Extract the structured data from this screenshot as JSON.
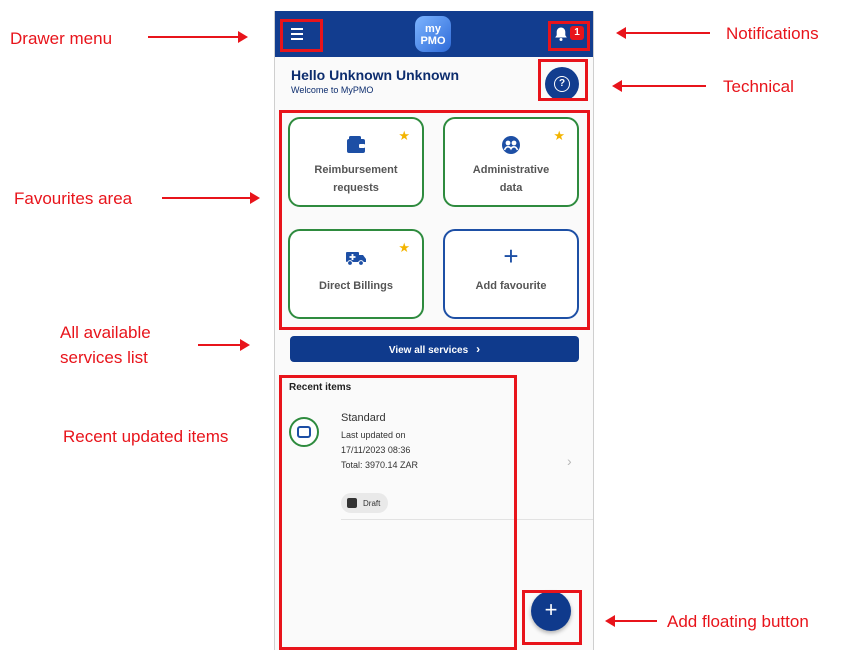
{
  "annotations": {
    "drawer_menu": "Drawer menu",
    "notifications": "Notifications",
    "technical": "Technical",
    "favourites_area": "Favourites area",
    "all_services_line1": "All available",
    "all_services_line2": "services list",
    "recent_items": "Recent updated items",
    "add_floating": "Add floating button",
    "color": "#e8141b"
  },
  "app": {
    "logo_text_top": "my",
    "logo_text_bottom": "PMO",
    "notification_count": "1",
    "brand_color": "#123d8f"
  },
  "greeting": {
    "title": "Hello Unknown Unknown",
    "subtitle": "Welcome to MyPMO"
  },
  "favourites": [
    {
      "label_line1": "Reimbursement",
      "label_line2": "requests",
      "icon": "wallet-icon",
      "starred": true
    },
    {
      "label_line1": "Administrative",
      "label_line2": "data",
      "icon": "people-icon",
      "starred": true
    },
    {
      "label_line1": "Direct Billings",
      "label_line2": "",
      "icon": "ambulance-icon",
      "starred": true
    },
    {
      "label_line1": "Add favourite",
      "label_line2": "",
      "icon": "plus-icon",
      "starred": false
    }
  ],
  "view_all": {
    "label": "View all services",
    "chevron": "›"
  },
  "recent": {
    "title": "Recent items",
    "items": [
      {
        "name": "Standard",
        "updated_label": "Last updated on",
        "updated_at": "17/11/2023 08:36",
        "total": "Total: 3970.14 ZAR",
        "status": "Draft"
      }
    ]
  },
  "fab": {
    "label": "+"
  },
  "icons": {
    "chevron_right": "›",
    "star": "★"
  }
}
